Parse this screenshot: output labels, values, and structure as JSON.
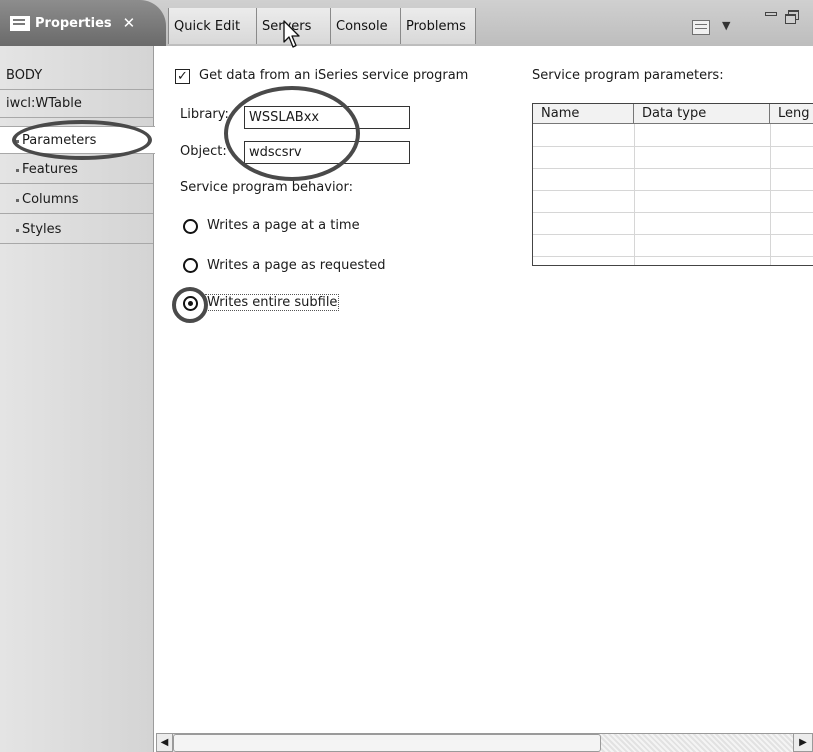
{
  "tabs": {
    "active": {
      "label": "Properties",
      "close": "✕"
    },
    "others": [
      "Quick Edit",
      "Servers",
      "Console",
      "Problems"
    ]
  },
  "toolbar": {
    "dropdown_glyph": "▼"
  },
  "nav": {
    "items": [
      "BODY",
      "iwcl:WTable",
      "Parameters",
      "Features",
      "Columns",
      "Styles"
    ],
    "selected": "Parameters"
  },
  "form": {
    "get_data_checkbox": {
      "label": "Get data from an iSeries service program",
      "checked": true,
      "mark": "✓"
    },
    "library": {
      "label": "Library:",
      "value": "WSSLABxx"
    },
    "object": {
      "label": "Object:",
      "value": "wdscsrv"
    },
    "behavior_label": "Service program behavior:",
    "behavior_options": [
      "Writes a page at a time",
      "Writes a page as requested",
      "Writes entire subfile"
    ],
    "behavior_selected": 2
  },
  "params_table": {
    "title": "Service program parameters:",
    "columns": [
      "Name",
      "Data type",
      "Leng"
    ]
  },
  "scrollbar": {
    "left_arrow": "◀",
    "right_arrow": "▶"
  },
  "colors": {
    "active_tab": "#7a7a7a",
    "tab_bar": "#c8c8c8",
    "nav_bg": "#dcdcdc",
    "annotation": "#4a4a4a"
  }
}
